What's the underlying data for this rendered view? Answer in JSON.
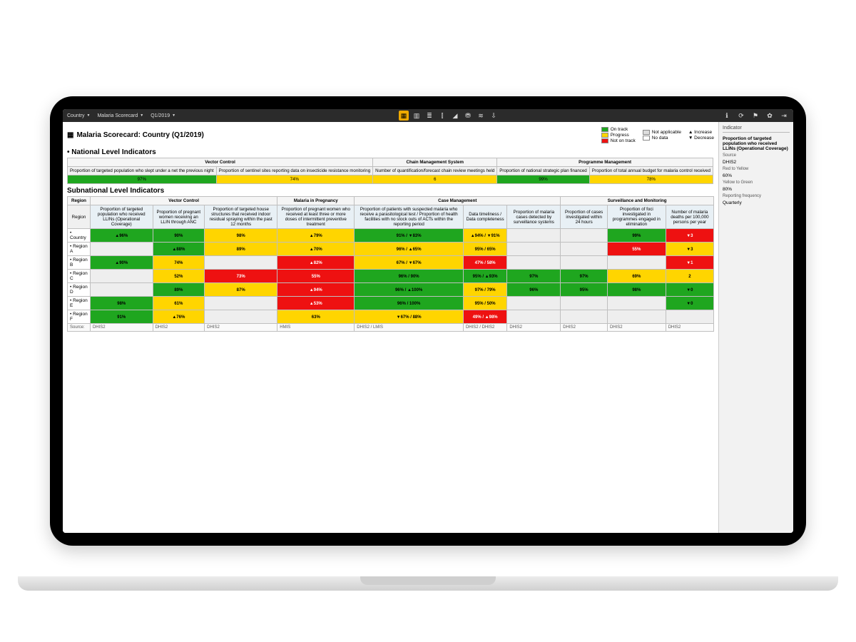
{
  "topbar": {
    "menu": [
      "Country",
      "Malaria Scorecard",
      "Q1/2019"
    ],
    "center_icons": [
      "▦",
      "▥",
      "≣",
      "⫿",
      "◢",
      "⛃",
      "≋",
      "⇩"
    ],
    "right_icons": [
      "ℹ",
      "⟳",
      "⚑",
      "✿",
      "⇥"
    ]
  },
  "title": "Malaria Scorecard: Country (Q1/2019)",
  "legend": {
    "col1": [
      [
        "#1fa61f",
        "On track"
      ],
      [
        "#ffd500",
        "Progress"
      ],
      [
        "#e11",
        "Not on track"
      ]
    ],
    "col2": [
      [
        "#ddd",
        "Not applicable"
      ],
      [
        "#fff",
        "No data"
      ]
    ],
    "col3": [
      "▲ Increase",
      "▼ Decrease"
    ]
  },
  "section_national_title": "• National Level Indicators",
  "national_groups": [
    "Vector Control",
    "Chain Management System",
    "Programme Management"
  ],
  "national_indicators": [
    "Proportion of targeted population who slept under a net the previous night",
    "Proportion of sentinel sites reporting data on insecticide resistance monitoring",
    "Number of quantification/forecast chain review meetings held",
    "Proportion of national strategic plan financed",
    "Proportion of total annual budget for malaria control received"
  ],
  "national_values": [
    {
      "v": "97%",
      "c": "green"
    },
    {
      "v": "74%",
      "c": "yellow"
    },
    {
      "v": "6",
      "c": "yellow"
    },
    {
      "v": "99%",
      "c": "green"
    },
    {
      "v": "78%",
      "c": "yellow"
    }
  ],
  "section_sub_title": "Subnational Level Indicators",
  "sub_group_headers": [
    "Region",
    "Vector Control",
    "Malaria in Pregnancy",
    "Case Management",
    "Surveillance and Monitoring"
  ],
  "sub_group_spans": [
    1,
    3,
    1,
    3,
    5
  ],
  "sub_indicators": [
    "Region",
    "Proportion of targeted population who received LLINs (Operational Coverage)",
    "Proportion of pregnant women receiving an LLIN through ANC",
    "Proportion of targeted house structures that received indoor residual spraying within the past 12 months",
    "Proportion of pregnant women who received at least three or more doses of intermittent preventive treatment",
    "Proportion of patients with suspected malaria who receive a parasitological test / Proportion of health facilities with no stock outs of ACTs within the reporting period",
    "Data timeliness / Data completeness",
    "Proportion of malaria cases detected by surveillance systems",
    "Proportion of cases investigated within 24 hours",
    "Proportion of foci investigated in programmes engaged in elimination",
    "Number of malaria deaths per 100,000 persons per year"
  ],
  "sub_rows": [
    {
      "label": "• Country",
      "cells": [
        {
          "v": "▲96%",
          "c": "green"
        },
        {
          "v": "90%",
          "c": "green"
        },
        {
          "v": "98%",
          "c": "yellow"
        },
        {
          "v": "▲79%",
          "c": "yellow"
        },
        {
          "v": "91% / ▼83%",
          "c": "green"
        },
        {
          "v": "▲94% / ▼91%",
          "c": "yellow"
        },
        {
          "v": "",
          "c": "grey"
        },
        {
          "v": "",
          "c": "grey"
        },
        {
          "v": "99%",
          "c": "green"
        },
        {
          "v": "▼3",
          "c": "red"
        }
      ]
    },
    {
      "label": "• Region A",
      "cells": [
        {
          "v": "",
          "c": "grey"
        },
        {
          "v": "▲88%",
          "c": "green"
        },
        {
          "v": "89%",
          "c": "yellow"
        },
        {
          "v": "▲70%",
          "c": "yellow"
        },
        {
          "v": "96% / ▲65%",
          "c": "yellow"
        },
        {
          "v": "95% / 65%",
          "c": "yellow"
        },
        {
          "v": "",
          "c": "grey"
        },
        {
          "v": "",
          "c": "grey"
        },
        {
          "v": "55%",
          "c": "red"
        },
        {
          "v": "▼3",
          "c": "yellow"
        }
      ]
    },
    {
      "label": "• Region B",
      "cells": [
        {
          "v": "▲90%",
          "c": "green"
        },
        {
          "v": "74%",
          "c": "yellow"
        },
        {
          "v": "",
          "c": "grey"
        },
        {
          "v": "▲82%",
          "c": "red"
        },
        {
          "v": "67% / ▼67%",
          "c": "yellow"
        },
        {
          "v": "47% / 58%",
          "c": "red"
        },
        {
          "v": "",
          "c": "grey"
        },
        {
          "v": "",
          "c": "grey"
        },
        {
          "v": "",
          "c": "grey"
        },
        {
          "v": "▼1",
          "c": "red"
        }
      ]
    },
    {
      "label": "• Region C",
      "cells": [
        {
          "v": "",
          "c": "grey"
        },
        {
          "v": "52%",
          "c": "yellow"
        },
        {
          "v": "73%",
          "c": "red"
        },
        {
          "v": "55%",
          "c": "red"
        },
        {
          "v": "96% / 90%",
          "c": "green"
        },
        {
          "v": "95% / ▲93%",
          "c": "green"
        },
        {
          "v": "97%",
          "c": "green"
        },
        {
          "v": "97%",
          "c": "green"
        },
        {
          "v": "69%",
          "c": "yellow"
        },
        {
          "v": "2",
          "c": "yellow"
        }
      ]
    },
    {
      "label": "• Region D",
      "cells": [
        {
          "v": "",
          "c": "grey"
        },
        {
          "v": "89%",
          "c": "green"
        },
        {
          "v": "87%",
          "c": "yellow"
        },
        {
          "v": "▲94%",
          "c": "red"
        },
        {
          "v": "96% / ▲100%",
          "c": "green"
        },
        {
          "v": "97% / 79%",
          "c": "yellow"
        },
        {
          "v": "96%",
          "c": "green"
        },
        {
          "v": "95%",
          "c": "green"
        },
        {
          "v": "98%",
          "c": "green"
        },
        {
          "v": "▼0",
          "c": "green"
        }
      ]
    },
    {
      "label": "• Region E",
      "cells": [
        {
          "v": "98%",
          "c": "green"
        },
        {
          "v": "61%",
          "c": "yellow"
        },
        {
          "v": "",
          "c": "grey"
        },
        {
          "v": "▲53%",
          "c": "red"
        },
        {
          "v": "96% / 100%",
          "c": "green"
        },
        {
          "v": "95% / 50%",
          "c": "yellow"
        },
        {
          "v": "",
          "c": "grey"
        },
        {
          "v": "",
          "c": "grey"
        },
        {
          "v": "",
          "c": "grey"
        },
        {
          "v": "▼0",
          "c": "green"
        }
      ]
    },
    {
      "label": "• Region F",
      "cells": [
        {
          "v": "91%",
          "c": "green"
        },
        {
          "v": "▲76%",
          "c": "yellow"
        },
        {
          "v": "",
          "c": "grey"
        },
        {
          "v": "63%",
          "c": "yellow"
        },
        {
          "v": "▼67% / 88%",
          "c": "yellow"
        },
        {
          "v": "49% / ▲98%",
          "c": "red"
        },
        {
          "v": "",
          "c": "grey"
        },
        {
          "v": "",
          "c": "grey"
        },
        {
          "v": "",
          "c": "grey"
        },
        {
          "v": "",
          "c": "grey"
        }
      ]
    }
  ],
  "sources": [
    "Source:",
    "DHIS2",
    "DHIS2",
    "DHIS2",
    "HMIS",
    "DHIS2 / LMIS",
    "DHIS2 / DHIS2",
    "DHIS2",
    "DHIS2",
    "DHIS2",
    "DHIS2"
  ],
  "side": {
    "heading": "Indicator",
    "title": "Proportion of targeted population who received LLINs (Operational Coverage)",
    "source_label": "Source",
    "source_value": "DHIS2",
    "r2y_label": "Red to Yellow",
    "r2y_value": "60%",
    "y2g_label": "Yellow to Green",
    "y2g_value": "80%",
    "freq_label": "Reporting frequency",
    "freq_value": "Quarterly"
  }
}
